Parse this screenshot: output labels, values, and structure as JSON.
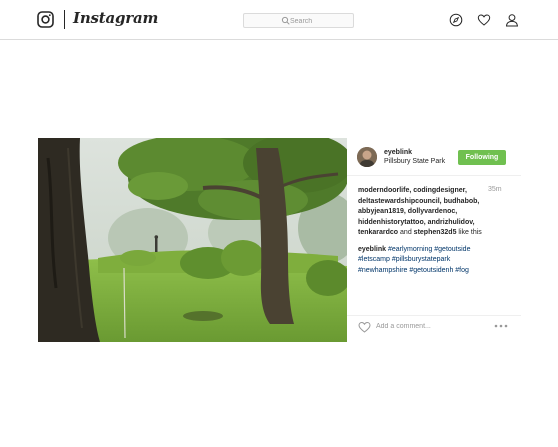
{
  "app": {
    "wordmark": "Instagram"
  },
  "search": {
    "placeholder": "Search"
  },
  "nav": {
    "icons": [
      "explore-icon",
      "heart-icon",
      "profile-icon"
    ]
  },
  "post": {
    "username": "eyeblink",
    "location": "Pillsbury State Park",
    "follow_label": "Following",
    "timestamp": "35m",
    "likes": {
      "users": "moderndoorlife, codingdesigner, deltastewardshipcouncil, budhabob, abbyjean1819, dollyvardenoc, hiddenhistorytattoo, andrizhulidov, tenkarardco",
      "connector": "and",
      "last_user": "stephen32d5",
      "suffix": "like this"
    },
    "caption": {
      "username": "eyeblink",
      "hashtags": "#earlymorning #getoutside #letscamp #pillsburystatepark #newhampshire #getoutsidenh #fog"
    },
    "comment_placeholder": "Add a comment...",
    "more_icon": "more-options-icon"
  },
  "colors": {
    "follow_green": "#70c050",
    "hashtag_blue": "#003569",
    "border": "#dbdbdb"
  }
}
